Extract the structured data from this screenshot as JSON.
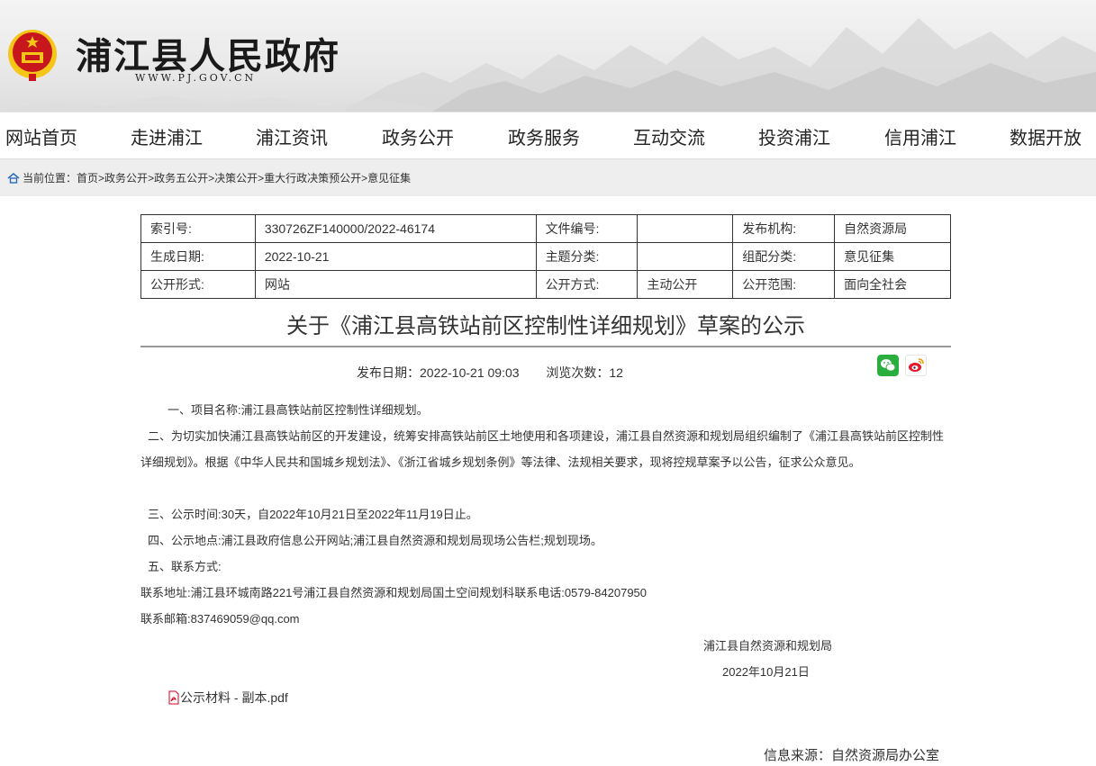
{
  "header": {
    "site_title": "浦江县人民政府",
    "site_url": "WWW.PJ.GOV.CN"
  },
  "nav": {
    "items": [
      "网站首页",
      "走进浦江",
      "浦江资讯",
      "政务公开",
      "政务服务",
      "互动交流",
      "投资浦江",
      "信用浦江",
      "数据开放"
    ]
  },
  "breadcrumb": {
    "prefix": "当前位置：",
    "items": [
      "首页",
      "政务公开",
      "政务五公开",
      "决策公开",
      "重大行政决策预公开",
      "意见征集"
    ],
    "separator": ">"
  },
  "meta": {
    "rows": [
      [
        "索引号:",
        "330726ZF140000/2022-46174",
        "文件编号:",
        "",
        "发布机构:",
        "自然资源局"
      ],
      [
        "生成日期:",
        "2022-10-21",
        "主题分类:",
        "",
        "组配分类:",
        "意见征集"
      ],
      [
        "公开形式:",
        "网站",
        "公开方式:",
        "主动公开",
        "公开范围:",
        "面向全社会"
      ]
    ]
  },
  "article": {
    "title": "关于《浦江县高铁站前区控制性详细规划》草案的公示",
    "publish_label": "发布日期：",
    "publish_date": "2022-10-21 09:03",
    "views_label": "浏览次数：",
    "views": "12",
    "paragraphs": [
      "一、项目名称:浦江县高铁站前区控制性详细规划。",
      "二、为切实加快浦江县高铁站前区的开发建设，统筹安排高铁站前区土地使用和各项建设，浦江县自然资源和规划局组织编制了《浦江县高铁站前区控制性详细规划》。根据《中华人民共和国城乡规划法》、《浙江省城乡规划条例》等法律、法规相关要求，现将控规草案予以公告，征求公众意见。",
      "三、公示时间:30天，自2022年10月21日至2022年11月19日止。",
      "四、公示地点:浦江县政府信息公开网站;浦江县自然资源和规划局现场公告栏;规划现场。",
      "五、联系方式:",
      "联系地址:浦江县环城南路221号浦江县自然资源和规划局国土空间规划科联系电话:0579-84207950",
      "联系邮箱:837469059@qq.com"
    ],
    "signature_org": "浦江县自然资源和规划局",
    "signature_date": "2022年10月21日",
    "attachment": "公示材料 - 副本.pdf",
    "source_label": "信息来源：",
    "source": "自然资源局办公室"
  },
  "icons": {
    "wechat": "wechat-share-icon",
    "weibo": "weibo-share-icon",
    "pdf": "pdf-file-icon",
    "home": "home-icon"
  },
  "colors": {
    "wechat": "#2aae3d",
    "weibo": "#e6162d",
    "emblem_red": "#c8161d",
    "emblem_gold": "#f5c518"
  }
}
